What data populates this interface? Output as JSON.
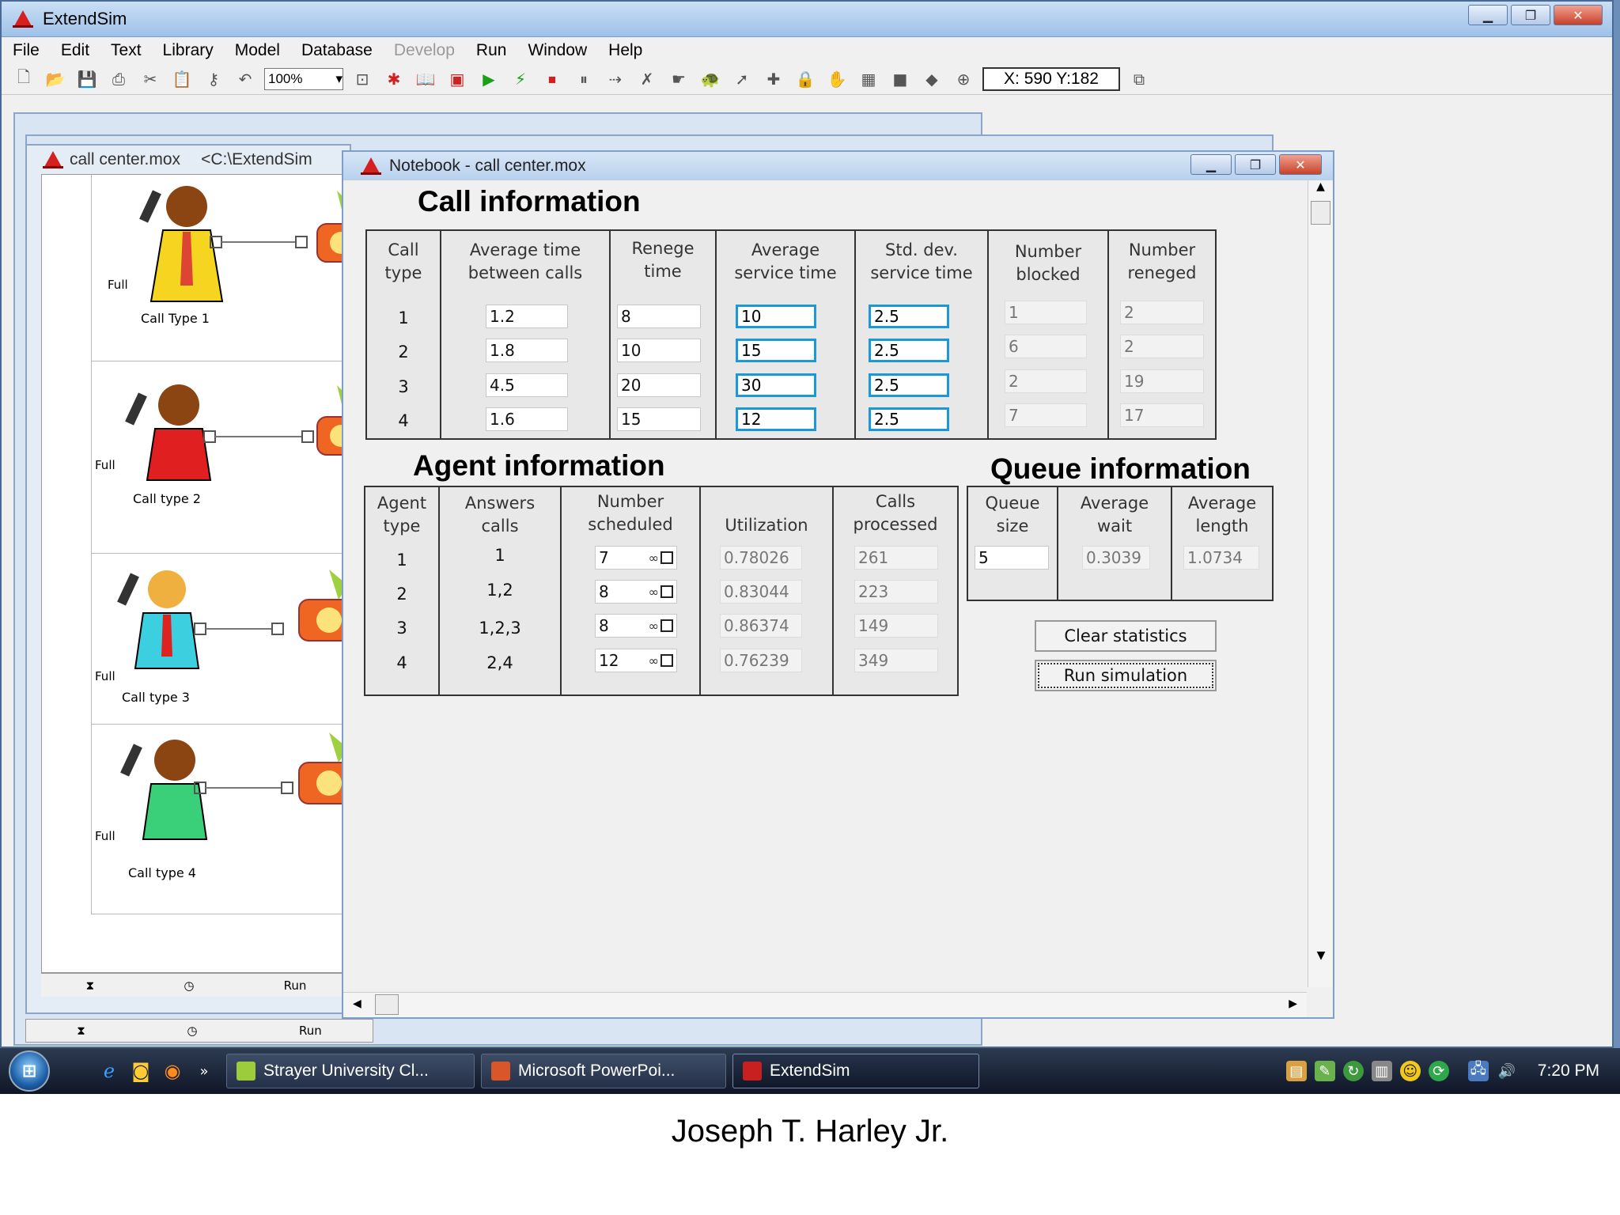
{
  "app": {
    "title": "ExtendSim"
  },
  "menu": [
    "File",
    "Edit",
    "Text",
    "Library",
    "Model",
    "Database",
    "Develop",
    "Run",
    "Window",
    "Help"
  ],
  "toolbar": {
    "zoom": "100%",
    "coords": "X: 590 Y:182"
  },
  "model_window": {
    "title": "call center.mox",
    "path": "<C:\\ExtendSim",
    "call_types": [
      "Call Type 1",
      "Call type 2",
      "Call type 3",
      "Call type 4"
    ],
    "full_label": "Full",
    "status_run": "Run"
  },
  "notebook": {
    "title": "Notebook - call center.mox",
    "call_info": {
      "title": "Call information",
      "headers": [
        "Call\ntype",
        "Average time\nbetween calls",
        "Renege\ntime",
        "Average\nservice time",
        "Std. dev.\nservice time",
        "Number\nblocked",
        "Number\nreneged"
      ],
      "rows": [
        {
          "type": "1",
          "between": "1.2",
          "renege": "8",
          "service": "10",
          "stddev": "2.5",
          "blocked": "1",
          "reneged": "2"
        },
        {
          "type": "2",
          "between": "1.8",
          "renege": "10",
          "service": "15",
          "stddev": "2.5",
          "blocked": "6",
          "reneged": "2"
        },
        {
          "type": "3",
          "between": "4.5",
          "renege": "20",
          "service": "30",
          "stddev": "2.5",
          "blocked": "2",
          "reneged": "19"
        },
        {
          "type": "4",
          "between": "1.6",
          "renege": "15",
          "service": "12",
          "stddev": "2.5",
          "blocked": "7",
          "reneged": "17"
        }
      ]
    },
    "agent_info": {
      "title": "Agent information",
      "headers": [
        "Agent\ntype",
        "Answers\ncalls",
        "Number\nscheduled",
        "Utilization",
        "Calls\nprocessed"
      ],
      "rows": [
        {
          "type": "1",
          "answers": "1",
          "scheduled": "7",
          "utilization": "0.78026",
          "processed": "261"
        },
        {
          "type": "2",
          "answers": "1,2",
          "scheduled": "8",
          "utilization": "0.83044",
          "processed": "223"
        },
        {
          "type": "3",
          "answers": "1,2,3",
          "scheduled": "8",
          "utilization": "0.86374",
          "processed": "149"
        },
        {
          "type": "4",
          "answers": "2,4",
          "scheduled": "12",
          "utilization": "0.76239",
          "processed": "349"
        }
      ]
    },
    "queue_info": {
      "title": "Queue information",
      "headers": [
        "Queue\nsize",
        "Average\nwait",
        "Average\nlength"
      ],
      "values": {
        "size": "5",
        "wait": "0.3039",
        "length": "1.0734"
      }
    },
    "buttons": {
      "clear": "Clear statistics",
      "run": "Run simulation"
    }
  },
  "taskbar": {
    "tasks": [
      "Strayer University Cl...",
      "Microsoft PowerPoi...",
      "ExtendSim"
    ],
    "clock": "7:20 PM"
  },
  "caption": "Joseph T. Harley Jr."
}
